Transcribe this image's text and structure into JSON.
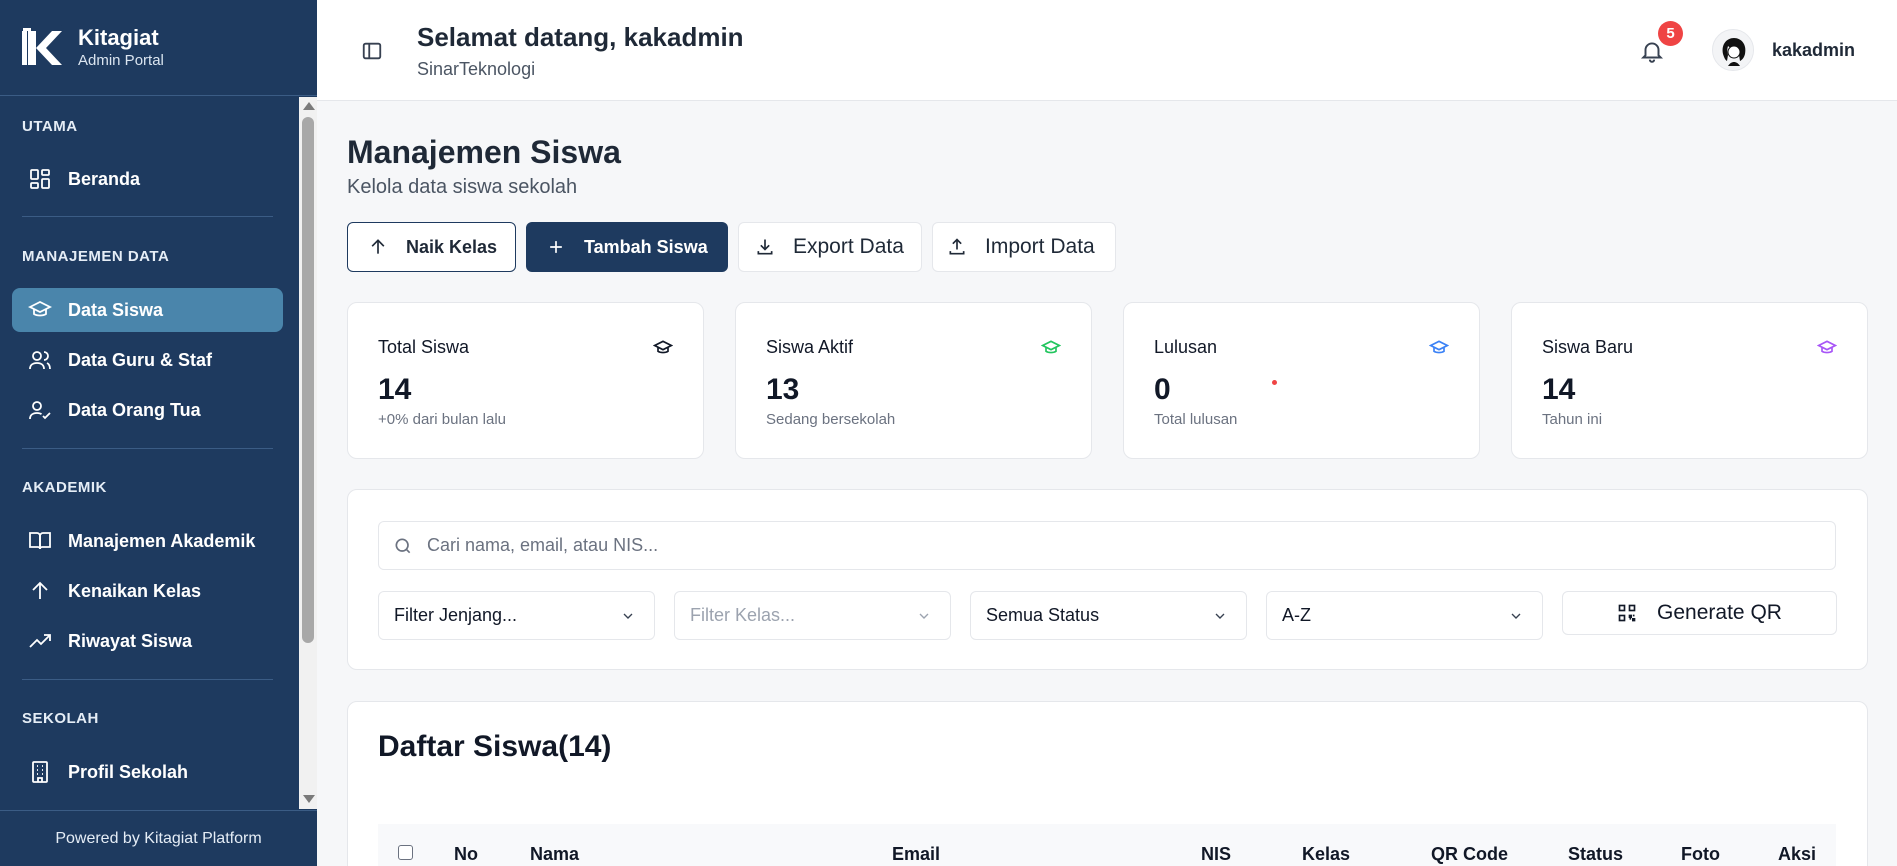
{
  "brand": {
    "title": "Kitagiat",
    "subtitle": "Admin Portal"
  },
  "sidebar": {
    "sections": [
      {
        "title": "UTAMA"
      },
      {
        "title": "MANAJEMEN DATA"
      },
      {
        "title": "AKADEMIK"
      },
      {
        "title": "SEKOLAH"
      }
    ],
    "items": [
      {
        "label": "Beranda",
        "icon": "dashboard-icon"
      },
      {
        "label": "Data Siswa",
        "icon": "graduation-cap-icon",
        "active": true
      },
      {
        "label": "Data Guru & Staf",
        "icon": "users-icon"
      },
      {
        "label": "Data Orang Tua",
        "icon": "user-check-icon"
      },
      {
        "label": "Manajemen Akademik",
        "icon": "book-open-icon"
      },
      {
        "label": "Kenaikan Kelas",
        "icon": "arrow-up-icon"
      },
      {
        "label": "Riwayat Siswa",
        "icon": "trending-up-icon"
      },
      {
        "label": "Profil Sekolah",
        "icon": "building-icon"
      }
    ],
    "footer": "Powered by Kitagiat Platform"
  },
  "header": {
    "welcome": "Selamat datang, kakadmin",
    "organization": "SinarTeknologi",
    "notification_count": "5",
    "username": "kakadmin"
  },
  "page": {
    "title": "Manajemen Siswa",
    "subtitle": "Kelola data siswa sekolah"
  },
  "actions": {
    "naik_kelas": "Naik Kelas",
    "tambah_siswa": "Tambah Siswa",
    "export_data": "Export Data",
    "import_data": "Import Data"
  },
  "stats": [
    {
      "label": "Total Siswa",
      "value": "14",
      "note": "+0% dari bulan lalu",
      "color": "#111827"
    },
    {
      "label": "Siswa Aktif",
      "value": "13",
      "note": "Sedang bersekolah",
      "color": "#22c55e"
    },
    {
      "label": "Lulusan",
      "value": "0",
      "note": "Total lulusan",
      "color": "#3b82f6"
    },
    {
      "label": "Siswa Baru",
      "value": "14",
      "note": "Tahun ini",
      "color": "#a855f7"
    }
  ],
  "filters": {
    "search_placeholder": "Cari nama, email, atau NIS...",
    "jenjang": "Filter Jenjang...",
    "kelas": "Filter Kelas...",
    "status": "Semua Status",
    "sort": "A-Z",
    "generate_qr": "Generate QR"
  },
  "list": {
    "title": "Daftar Siswa(14)",
    "columns": [
      "No",
      "Nama",
      "Email",
      "NIS",
      "Kelas",
      "QR Code",
      "Status",
      "Foto",
      "Aksi"
    ]
  },
  "colors": {
    "sidebar": "#1e3a5f",
    "active": "#4a85ab",
    "primary": "#1e3a5f",
    "badge": "#ef4444"
  }
}
